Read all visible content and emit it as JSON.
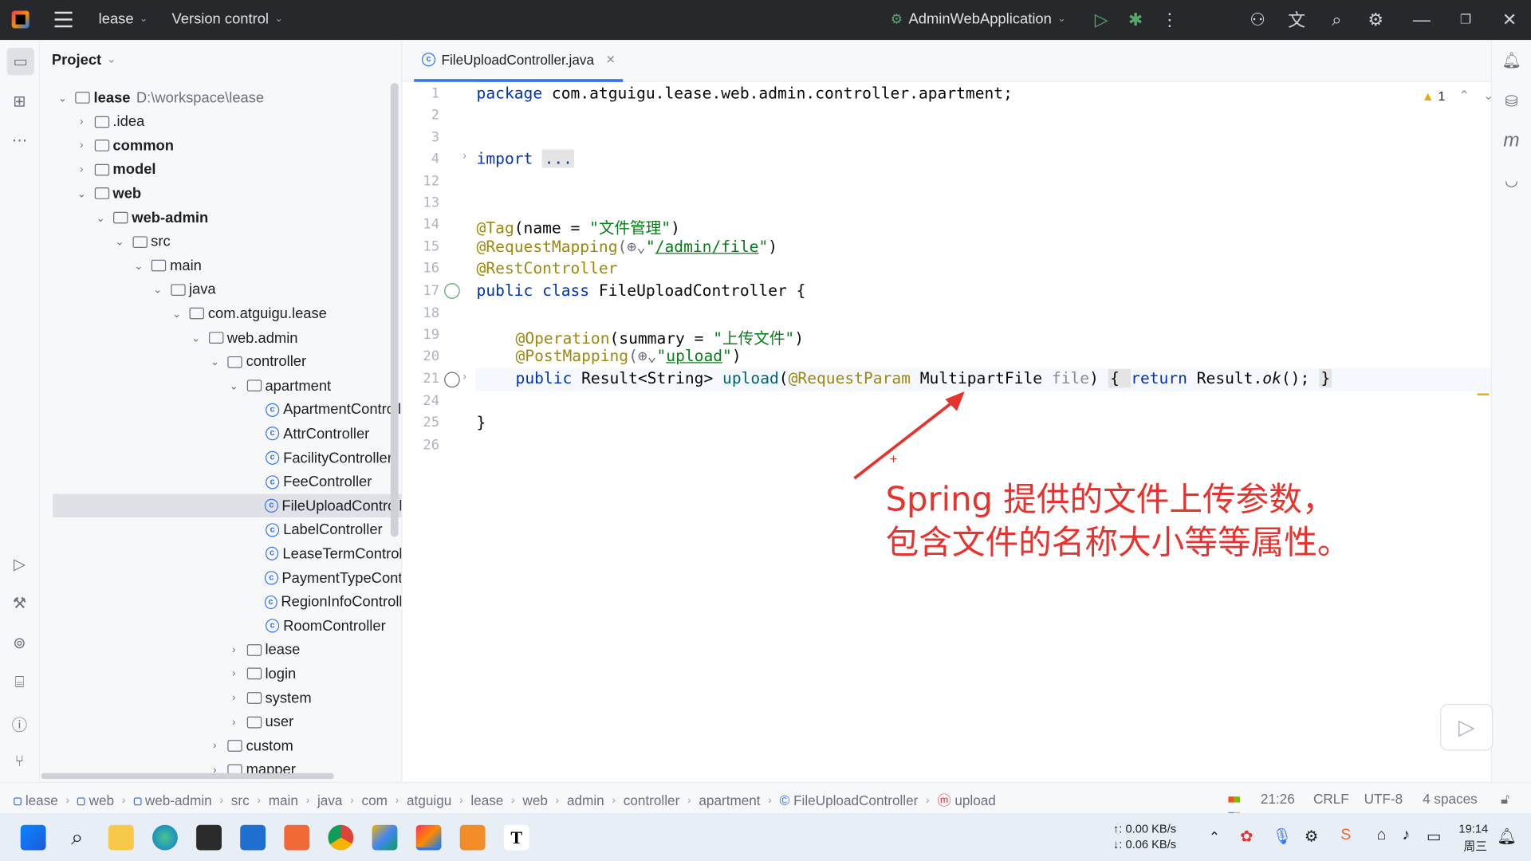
{
  "titlebar": {
    "project": "lease",
    "vcs": "Version control",
    "run_config": "AdminWebApplication"
  },
  "project_panel": {
    "title": "Project",
    "tree": [
      {
        "label": "lease",
        "hint": "D:\\workspace\\lease",
        "depth": 0,
        "expanded": true,
        "type": "module",
        "bold": true
      },
      {
        "label": ".idea",
        "depth": 1,
        "expanded": false,
        "type": "folder"
      },
      {
        "label": "common",
        "depth": 1,
        "expanded": false,
        "type": "module",
        "bold": true
      },
      {
        "label": "model",
        "depth": 1,
        "expanded": false,
        "type": "module",
        "bold": true
      },
      {
        "label": "web",
        "depth": 1,
        "expanded": true,
        "type": "module",
        "bold": true
      },
      {
        "label": "web-admin",
        "depth": 2,
        "expanded": true,
        "type": "module",
        "bold": true
      },
      {
        "label": "src",
        "depth": 3,
        "expanded": true,
        "type": "folder"
      },
      {
        "label": "main",
        "depth": 4,
        "expanded": true,
        "type": "folder"
      },
      {
        "label": "java",
        "depth": 5,
        "expanded": true,
        "type": "folder"
      },
      {
        "label": "com.atguigu.lease",
        "depth": 6,
        "expanded": true,
        "type": "package"
      },
      {
        "label": "web.admin",
        "depth": 7,
        "expanded": true,
        "type": "package"
      },
      {
        "label": "controller",
        "depth": 8,
        "expanded": true,
        "type": "package"
      },
      {
        "label": "apartment",
        "depth": 9,
        "expanded": true,
        "type": "package"
      },
      {
        "label": "ApartmentControll",
        "depth": 10,
        "type": "class"
      },
      {
        "label": "AttrController",
        "depth": 10,
        "type": "class"
      },
      {
        "label": "FacilityController",
        "depth": 10,
        "type": "class"
      },
      {
        "label": "FeeController",
        "depth": 10,
        "type": "class"
      },
      {
        "label": "FileUploadControll",
        "depth": 10,
        "type": "class",
        "selected": true
      },
      {
        "label": "LabelController",
        "depth": 10,
        "type": "class"
      },
      {
        "label": "LeaseTermControl",
        "depth": 10,
        "type": "class"
      },
      {
        "label": "PaymentTypeCont",
        "depth": 10,
        "type": "class"
      },
      {
        "label": "RegionInfoControll",
        "depth": 10,
        "type": "class"
      },
      {
        "label": "RoomController",
        "depth": 10,
        "type": "class"
      },
      {
        "label": "lease",
        "depth": 9,
        "expanded": false,
        "type": "package"
      },
      {
        "label": "login",
        "depth": 9,
        "expanded": false,
        "type": "package"
      },
      {
        "label": "system",
        "depth": 9,
        "expanded": false,
        "type": "package"
      },
      {
        "label": "user",
        "depth": 9,
        "expanded": false,
        "type": "package"
      },
      {
        "label": "custom",
        "depth": 8,
        "expanded": false,
        "type": "package"
      },
      {
        "label": "mapper",
        "depth": 8,
        "expanded": false,
        "type": "package"
      }
    ]
  },
  "editor": {
    "tab_label": "FileUploadController.java",
    "warning_count": "1",
    "line_numbers": [
      "1",
      "2",
      "3",
      "4",
      "12",
      "13",
      "14",
      "15",
      "16",
      "17",
      "18",
      "19",
      "20",
      "21",
      "24",
      "25",
      "26"
    ],
    "lines": {
      "l1_kw": "package",
      "l1_rest": " com.atguigu.lease.web.admin.controller.apartment;",
      "l4_kw": "import",
      "l4_fold": "...",
      "l14_ann": "@Tag",
      "l14_rest": "(name = ",
      "l14_str": "\"文件管理\"",
      "l14_end": ")",
      "l15_ann": "@RequestMapping",
      "l15_mid": "(⊕⌄",
      "l15_str1": "\"",
      "l15_url": "/admin/file",
      "l15_str2": "\"",
      "l15_end": ")",
      "l16_ann": "@RestController",
      "l17_kw": "public class",
      "l17_rest": " FileUploadController {",
      "l19_ann": "@Operation",
      "l19_rest": "(summary = ",
      "l19_str": "\"上传文件\"",
      "l19_end": ")",
      "l20_ann": "@PostMapping",
      "l20_mid": "(⊕⌄",
      "l20_str1": "\"",
      "l20_url": "upload",
      "l20_str2": "\"",
      "l20_end": ")",
      "l21_kw": "public",
      "l21_a": " Result<String> ",
      "l21_method": "upload",
      "l21_b": "(",
      "l21_ann": "@RequestParam",
      "l21_c": " MultipartFile ",
      "l21_param": "file",
      "l21_d": ") ",
      "l21_fold1": "{ ",
      "l21_kw2": "return",
      "l21_e": " Result.",
      "l21_ok": "ok",
      "l21_f": "(); ",
      "l21_fold2": "}",
      "l25": "}"
    }
  },
  "annotation": {
    "line1": "Spring 提供的文件上传参数，",
    "line2": "包含文件的名称大小等等属性。",
    "color": "#e8322e"
  },
  "statusbar": {
    "breadcrumbs": [
      "lease",
      "web",
      "web-admin",
      "src",
      "main",
      "java",
      "com",
      "atguigu",
      "lease",
      "web",
      "admin",
      "controller",
      "apartment",
      "FileUploadController",
      "upload"
    ],
    "position": "21:26",
    "line_sep": "CRLF",
    "encoding": "UTF-8",
    "indent": "4 spaces"
  },
  "taskbar": {
    "net_up": "↑: 0.00 KB/s",
    "net_down": "↓: 0.06 KB/s",
    "time": "19:14",
    "day": "周三"
  }
}
